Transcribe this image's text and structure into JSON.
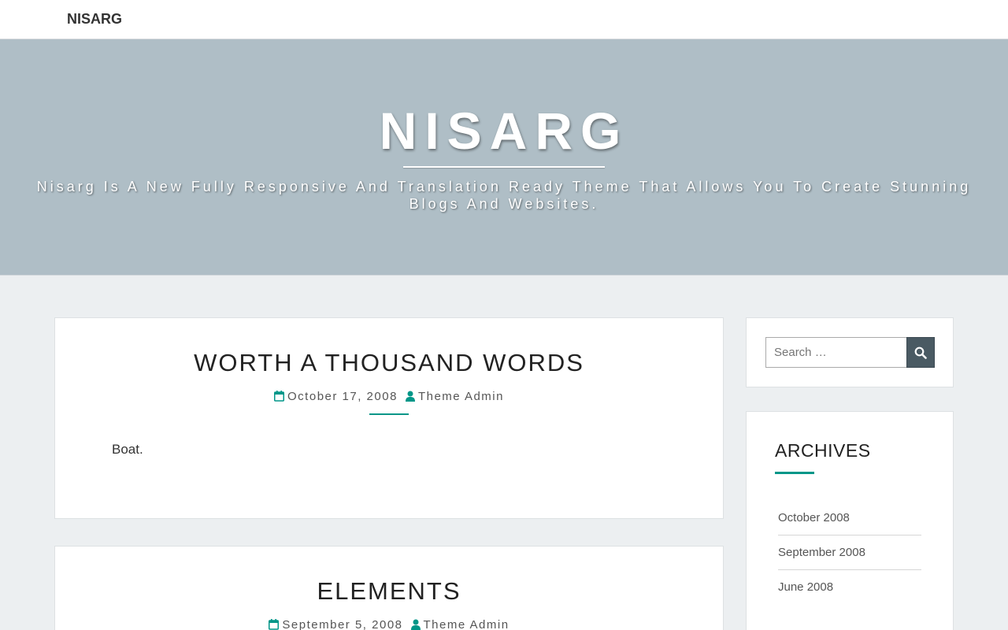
{
  "topbar": {
    "brand": "NISARG"
  },
  "hero": {
    "site_title": "NISARG",
    "tagline_line1": "Nisarg Is A New Fully Responsive And Translation Ready Theme That Allows You To Create Stunning",
    "tagline_line2": "Blogs And Websites."
  },
  "posts": [
    {
      "title": "WORTH A THOUSAND WORDS",
      "date": "October 17, 2008",
      "author": "Theme Admin",
      "excerpt": "Boat."
    },
    {
      "title": "ELEMENTS",
      "date": "September 5, 2008",
      "author": "Theme Admin"
    }
  ],
  "sidebar": {
    "search": {
      "placeholder": "Search …"
    },
    "archives": {
      "title": "ARCHIVES",
      "items": [
        "October 2008",
        "September 2008",
        "June 2008"
      ]
    }
  },
  "colors": {
    "accent": "#009688",
    "hero_bg": "#afbec6",
    "page_bg": "#eceff1",
    "search_button": "#4a5a63"
  },
  "icons": {
    "date": "calendar-icon",
    "author": "user-icon",
    "search": "search-icon"
  }
}
